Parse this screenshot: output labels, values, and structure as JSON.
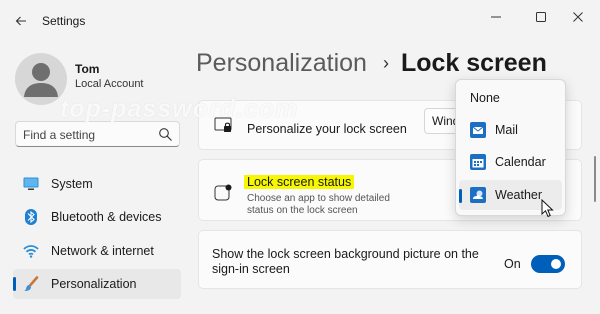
{
  "window": {
    "title": "Settings",
    "controls": [
      "minimize",
      "maximize",
      "close"
    ]
  },
  "user": {
    "name": "Tom",
    "account_type": "Local Account"
  },
  "search": {
    "placeholder": "Find a setting"
  },
  "sidebar": {
    "items": [
      {
        "label": "System",
        "icon": "monitor-icon"
      },
      {
        "label": "Bluetooth & devices",
        "icon": "bluetooth-icon"
      },
      {
        "label": "Network & internet",
        "icon": "wifi-icon"
      },
      {
        "label": "Personalization",
        "icon": "paintbrush-icon",
        "active": true
      }
    ]
  },
  "breadcrumb": {
    "parent": "Personalization",
    "separator": "›",
    "current": "Lock screen"
  },
  "watermark": "top-password.com",
  "cards": {
    "personalize": {
      "title": "Personalize your lock screen",
      "value": "Windows spotlight"
    },
    "status": {
      "title": "Lock screen status",
      "description": "Choose an app to show detailed status on the lock screen"
    },
    "signin": {
      "title": "Show the lock screen background picture on the sign-in screen",
      "toggle_label": "On",
      "toggle_on": true
    }
  },
  "status_menu": {
    "options": [
      {
        "label": "None",
        "icon": ""
      },
      {
        "label": "Mail",
        "icon": "mail-icon"
      },
      {
        "label": "Calendar",
        "icon": "calendar-icon"
      },
      {
        "label": "Weather",
        "icon": "weather-icon",
        "selected": true
      }
    ]
  },
  "colors": {
    "accent": "#005fb8",
    "highlight": "#f7f700",
    "background": "#f3f3f3",
    "card": "#fbfbfb"
  }
}
